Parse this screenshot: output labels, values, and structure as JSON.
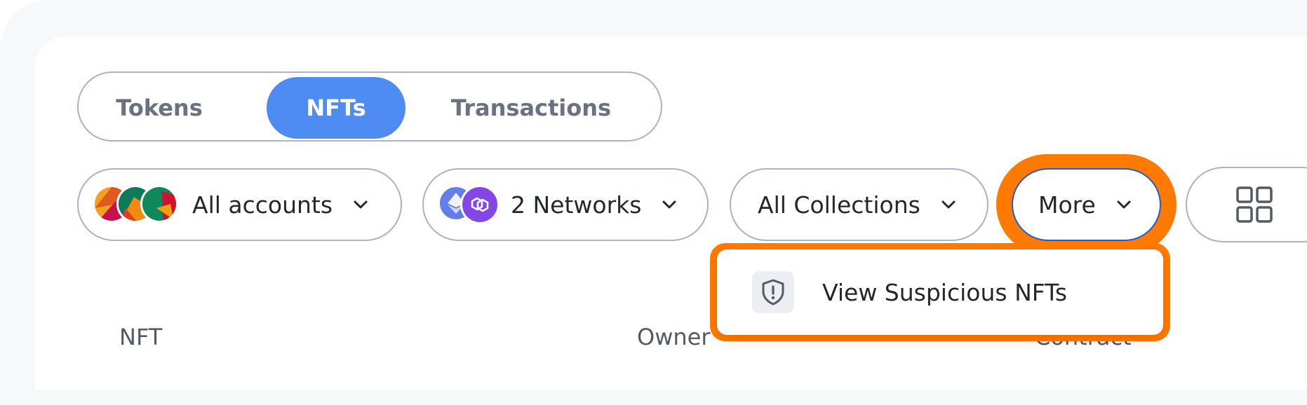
{
  "tabs": [
    {
      "label": "Tokens",
      "active": false
    },
    {
      "label": "NFTs",
      "active": true
    },
    {
      "label": "Transactions",
      "active": false
    }
  ],
  "filters": {
    "accounts_label": "All accounts",
    "networks_label": "2 Networks",
    "collections_label": "All Collections",
    "more_label": "More"
  },
  "menu": {
    "item_label": "View Suspicious NFTs",
    "item_icon": "shield-alert-icon"
  },
  "table": {
    "columns": [
      "NFT",
      "Owner",
      "Contract"
    ]
  },
  "colors": {
    "accent": "#4e8cf4",
    "highlight": "#ff7a00",
    "focus_border": "#1f5ad7"
  }
}
